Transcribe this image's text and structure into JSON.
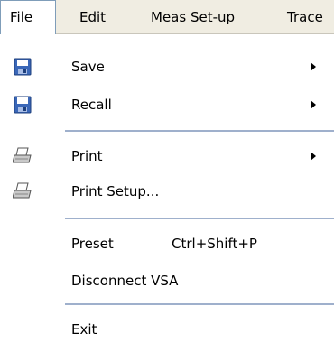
{
  "menubar": {
    "items": [
      {
        "label": "File"
      },
      {
        "label": "Edit"
      },
      {
        "label": "Meas Set-up"
      },
      {
        "label": "Trace"
      }
    ]
  },
  "file_menu": {
    "items": [
      {
        "label": "Save",
        "icon": "save-icon",
        "has_submenu": true
      },
      {
        "label": "Recall",
        "icon": "save-icon",
        "has_submenu": true
      },
      {
        "label": "Print",
        "icon": "printer-icon",
        "has_submenu": true
      },
      {
        "label": "Print Setup...",
        "icon": "printer-icon"
      },
      {
        "label": "Preset",
        "shortcut": "Ctrl+Shift+P"
      },
      {
        "label": "Disconnect VSA"
      },
      {
        "label": "Exit"
      }
    ]
  }
}
